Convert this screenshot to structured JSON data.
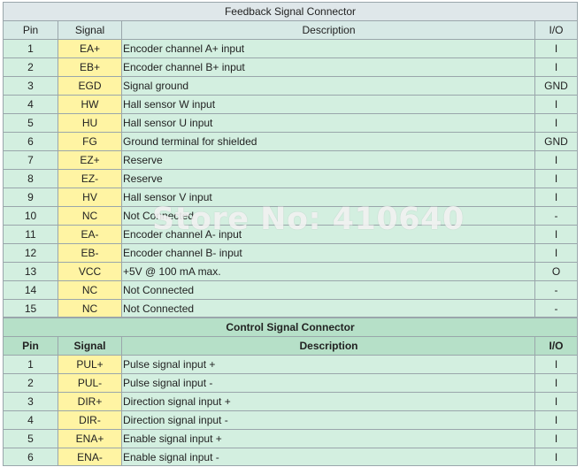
{
  "feedback": {
    "title": "Feedback Signal Connector",
    "headers": {
      "pin": "Pin",
      "signal": "Signal",
      "description": "Description",
      "io": "I/O"
    },
    "rows": [
      {
        "pin": "1",
        "signal": "EA+",
        "description": "Encoder channel A+ input",
        "io": "I"
      },
      {
        "pin": "2",
        "signal": "EB+",
        "description": "Encoder channel B+ input",
        "io": "I"
      },
      {
        "pin": "3",
        "signal": "EGD",
        "description": "Signal ground",
        "io": "GND"
      },
      {
        "pin": "4",
        "signal": "HW",
        "description": "Hall sensor W input",
        "io": "I"
      },
      {
        "pin": "5",
        "signal": "HU",
        "description": "Hall sensor U input",
        "io": "I"
      },
      {
        "pin": "6",
        "signal": "FG",
        "description": "Ground terminal for shielded",
        "io": "GND"
      },
      {
        "pin": "7",
        "signal": "EZ+",
        "description": "Reserve",
        "io": "I"
      },
      {
        "pin": "8",
        "signal": "EZ-",
        "description": "Reserve",
        "io": "I"
      },
      {
        "pin": "9",
        "signal": "HV",
        "description": "Hall sensor V input",
        "io": "I"
      },
      {
        "pin": "10",
        "signal": "NC",
        "description": "Not Connected",
        "io": "-"
      },
      {
        "pin": "11",
        "signal": "EA-",
        "description": "Encoder channel A- input",
        "io": "I"
      },
      {
        "pin": "12",
        "signal": "EB-",
        "description": "Encoder channel B- input",
        "io": "I"
      },
      {
        "pin": "13",
        "signal": "VCC",
        "description": "+5V @ 100 mA max.",
        "io": "O"
      },
      {
        "pin": "14",
        "signal": "NC",
        "description": "Not Connected",
        "io": "-"
      },
      {
        "pin": "15",
        "signal": "NC",
        "description": "Not Connected",
        "io": "-"
      }
    ]
  },
  "control": {
    "title": "Control Signal Connector",
    "headers": {
      "pin": "Pin",
      "signal": "Signal",
      "description": "Description",
      "io": "I/O"
    },
    "rows": [
      {
        "pin": "1",
        "signal": "PUL+",
        "description": "Pulse signal input +",
        "io": "I"
      },
      {
        "pin": "2",
        "signal": "PUL-",
        "description": "Pulse signal input -",
        "io": "I"
      },
      {
        "pin": "3",
        "signal": "DIR+",
        "description": "Direction signal input +",
        "io": "I"
      },
      {
        "pin": "4",
        "signal": "DIR-",
        "description": "Direction signal input -",
        "io": "I"
      },
      {
        "pin": "5",
        "signal": "ENA+",
        "description": "Enable signal input +",
        "io": "I"
      },
      {
        "pin": "6",
        "signal": "ENA-",
        "description": "Enable signal input -",
        "io": "I"
      }
    ]
  },
  "watermark": "Store No: 410640",
  "colors": {
    "signal_cell": "#fff4a3",
    "data_cell": "#d3efe0",
    "header_green": "#b6e0c8",
    "title_gray": "#dfe7ea"
  }
}
